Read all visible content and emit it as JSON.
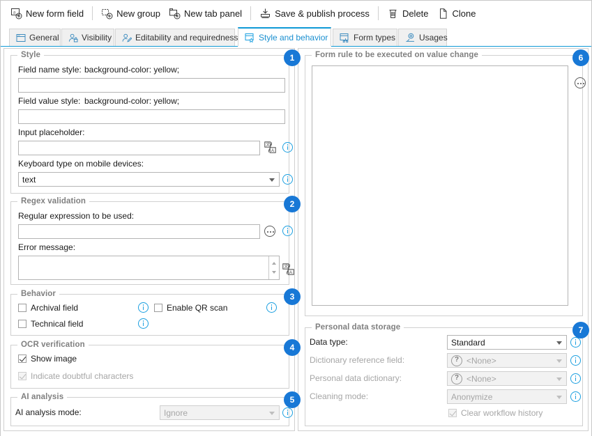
{
  "toolbar": {
    "items": [
      {
        "label": "New form field",
        "icon": "new-form-field-icon"
      },
      {
        "label": "New group",
        "icon": "new-group-icon"
      },
      {
        "label": "New tab panel",
        "icon": "new-tab-panel-icon"
      },
      {
        "label": "Save & publish process",
        "icon": "save-publish-icon"
      },
      {
        "label": "Delete",
        "icon": "trash-icon"
      },
      {
        "label": "Clone",
        "icon": "copy-icon"
      }
    ]
  },
  "tabs": [
    {
      "label": "General",
      "icon": "window-icon",
      "active": false
    },
    {
      "label": "Visibility",
      "icon": "user-lock-icon",
      "active": false
    },
    {
      "label": "Editability and requiredness",
      "icon": "user-pencil-icon",
      "active": false
    },
    {
      "label": "Style and behavior",
      "icon": "window-star-icon",
      "active": true
    },
    {
      "label": "Form types",
      "icon": "window-tree-icon",
      "active": false
    },
    {
      "label": "Usages",
      "icon": "usages-icon",
      "active": false
    }
  ],
  "style_group": {
    "caption": "Style",
    "badge": "1",
    "field_name_style_label": "Field name style:",
    "field_name_style_hint": "background-color: yellow;",
    "field_name_style_value": "",
    "field_value_style_label": "Field value style:",
    "field_value_style_hint": "background-color: yellow;",
    "field_value_style_value": "",
    "input_placeholder_label": "Input placeholder:",
    "input_placeholder_value": "",
    "keyboard_type_label": "Keyboard type on mobile devices:",
    "keyboard_type_value": "text"
  },
  "regex_group": {
    "caption": "Regex validation",
    "badge": "2",
    "regex_label": "Regular expression to be used:",
    "regex_value": "",
    "error_message_label": "Error message:",
    "error_message_value": ""
  },
  "behavior_group": {
    "caption": "Behavior",
    "badge": "3",
    "archival_field": {
      "label": "Archival field",
      "checked": false
    },
    "technical_field": {
      "label": "Technical field",
      "checked": false
    },
    "enable_qr_scan": {
      "label": "Enable QR scan",
      "checked": false
    }
  },
  "ocr_group": {
    "caption": "OCR verification",
    "badge": "4",
    "show_image": {
      "label": "Show image",
      "checked": true,
      "disabled": false
    },
    "indicate_doubtful": {
      "label": "Indicate doubtful characters",
      "checked": true,
      "disabled": true
    }
  },
  "ai_group": {
    "caption": "AI analysis",
    "badge": "5",
    "mode_label": "AI analysis mode:",
    "mode_value": "Ignore"
  },
  "form_rule_group": {
    "caption": "Form rule to be executed on value change",
    "badge": "6",
    "value": ""
  },
  "personal_data_group": {
    "caption": "Personal data storage",
    "badge": "7",
    "data_type_label": "Data type:",
    "data_type_value": "Standard",
    "dictionary_reference_label": "Dictionary reference field:",
    "dictionary_reference_value": "<None>",
    "personal_dictionary_label": "Personal data dictionary:",
    "personal_dictionary_value": "<None>",
    "cleaning_mode_label": "Cleaning mode:",
    "cleaning_mode_value": "Anonymize",
    "clear_workflow_history": {
      "label": "Clear workflow history",
      "checked": true,
      "disabled": true
    }
  },
  "colors": {
    "accent": "#1a9fe0",
    "badge": "#1878d6",
    "tab_active_text": "#1a8fd0",
    "caption": "#808080"
  }
}
